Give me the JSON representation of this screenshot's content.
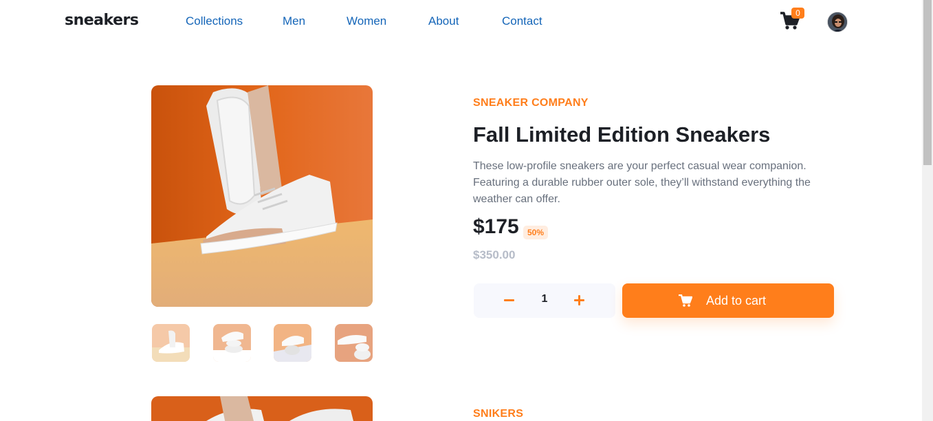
{
  "header": {
    "logo": "sneakers",
    "nav": [
      "Collections",
      "Men",
      "Women",
      "About",
      "Contact"
    ],
    "cart_count": "0",
    "cart_icon": "cart-icon",
    "avatar_icon": "user-avatar"
  },
  "product": {
    "company": "SNEAKER COMPANY",
    "title": "Fall Limited Edition Sneakers",
    "description": "These low-profile sneakers are your perfect casual wear companion. Featuring a durable rubber outer sole, they’ll withstand everything the weather can offer.",
    "price": "$175",
    "discount": "50%",
    "original_price": "$350.00",
    "quantity": "1",
    "add_to_cart": "Add to cart",
    "thumbnails": [
      "thumbnail-1",
      "thumbnail-2",
      "thumbnail-3",
      "thumbnail-4"
    ]
  },
  "second_product": {
    "company": "SNIKERS"
  },
  "colors": {
    "accent": "#ff7e1b",
    "nav_link": "#1465b8",
    "dark": "#1d2026",
    "muted": "#68707d",
    "pale": "#b6bcc8"
  }
}
